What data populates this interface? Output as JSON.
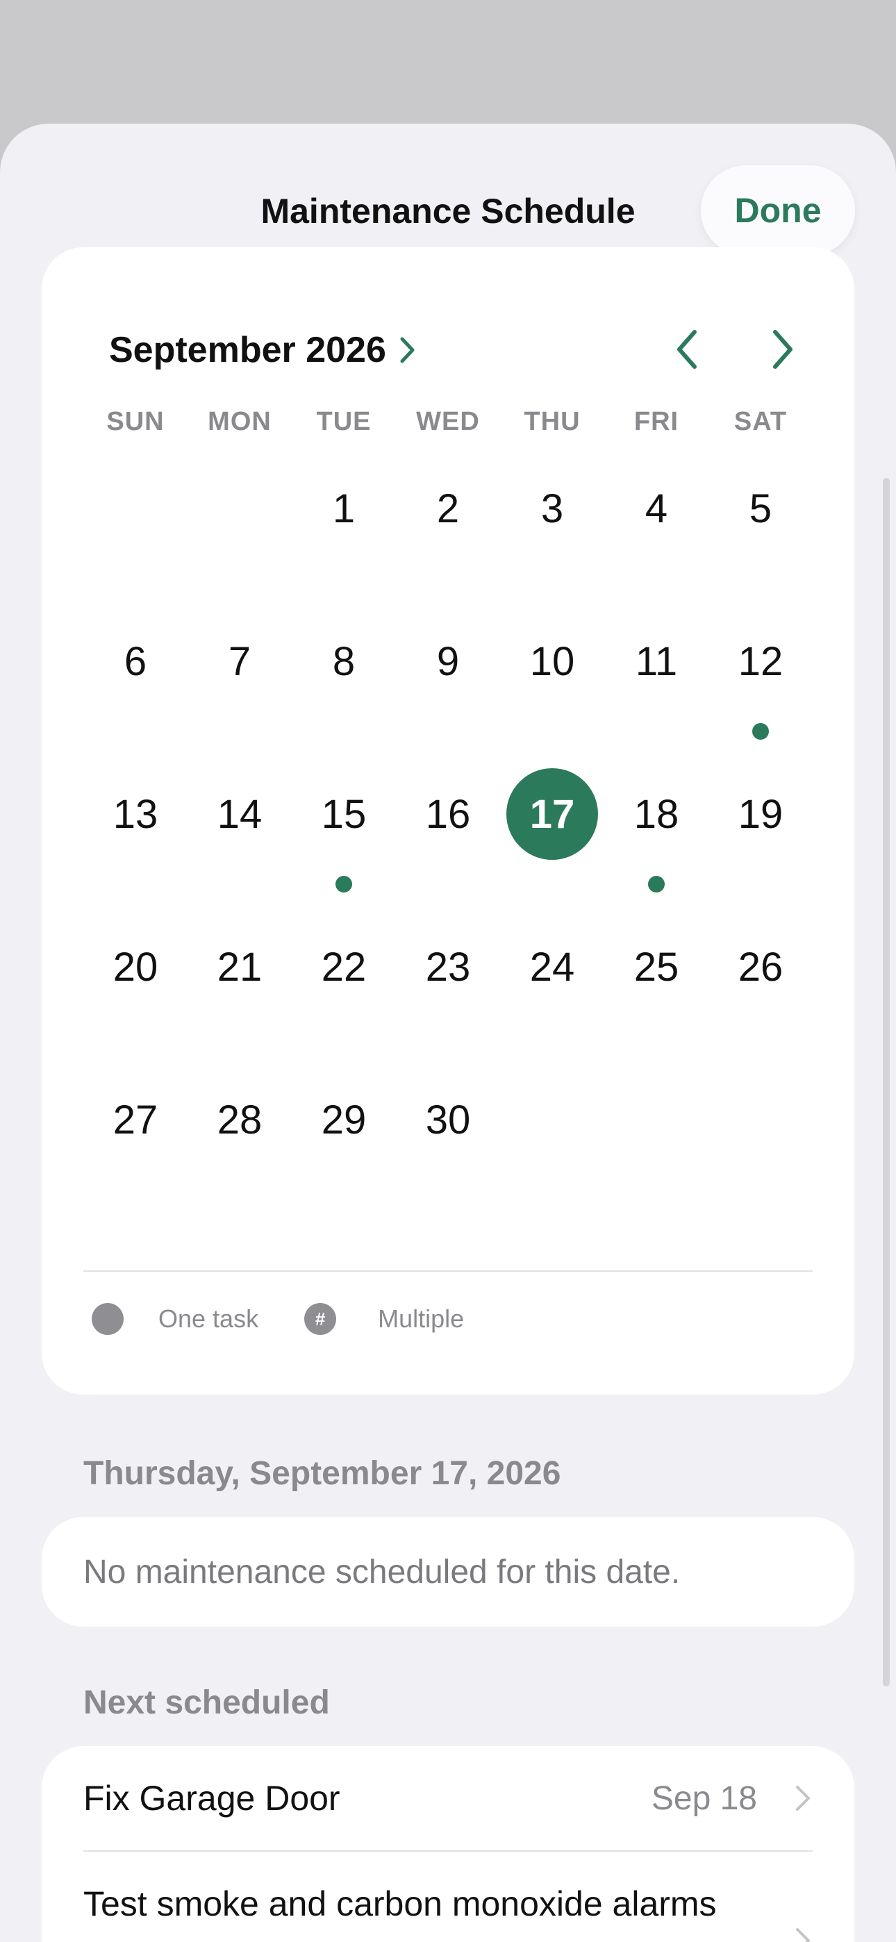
{
  "header": {
    "title": "Maintenance Schedule",
    "done_label": "Done"
  },
  "calendar": {
    "month_label": "September 2026",
    "weekdays": [
      "SUN",
      "MON",
      "TUE",
      "WED",
      "THU",
      "FRI",
      "SAT"
    ],
    "first_weekday_index": 2,
    "days_in_month": 30,
    "selected_day": 17,
    "task_days": [
      12,
      15,
      18
    ],
    "accent_color": "#2b7a5b"
  },
  "legend": {
    "single_label": "One task",
    "multiple_label": "Multiple",
    "multiple_symbol": "#"
  },
  "selected_date": {
    "heading": "Thursday, September 17, 2026",
    "empty_message": "No maintenance scheduled for this date."
  },
  "next_scheduled": {
    "heading": "Next scheduled",
    "items": [
      {
        "title": "Fix Garage Door",
        "date": "Sep 18"
      },
      {
        "title": "Test smoke and carbon monoxide alarms",
        "date": ""
      }
    ]
  }
}
